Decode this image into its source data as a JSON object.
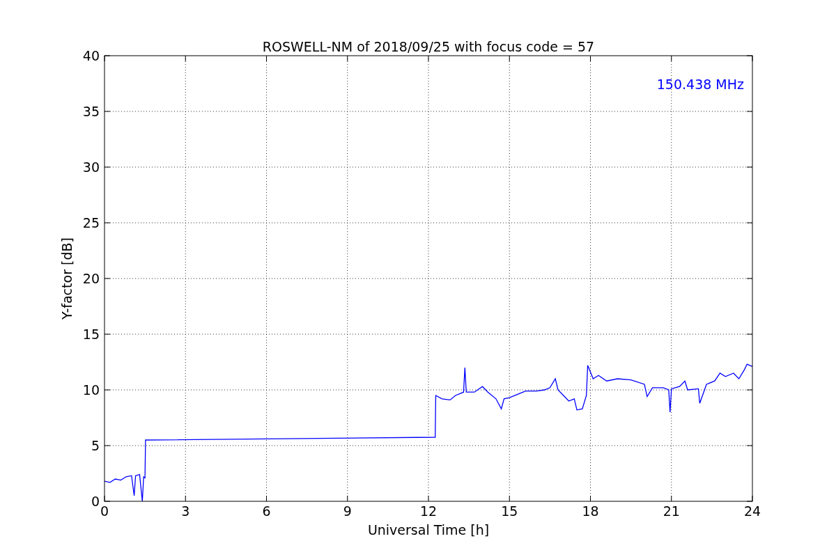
{
  "figure": {
    "chart_data": {
      "type": "line",
      "title": "ROSWELL-NM of 2018/09/25 with focus code = 57",
      "xlabel": "Universal Time [h]",
      "ylabel": "Y-factor [dB]",
      "x": [
        0,
        0.2,
        0.4,
        0.6,
        0.8,
        1.0,
        1.1,
        1.15,
        1.3,
        1.4,
        1.45,
        1.5,
        1.52,
        12.25,
        12.27,
        12.5,
        12.8,
        13.0,
        13.3,
        13.35,
        13.4,
        13.7,
        14.0,
        14.2,
        14.5,
        14.7,
        14.8,
        15.0,
        15.3,
        15.6,
        16.0,
        16.3,
        16.5,
        16.7,
        16.8,
        17.0,
        17.2,
        17.4,
        17.5,
        17.7,
        17.85,
        17.9,
        18.1,
        18.3,
        18.6,
        19.0,
        19.5,
        20.0,
        20.1,
        20.3,
        20.7,
        20.9,
        20.95,
        21.0,
        21.3,
        21.5,
        21.6,
        22.0,
        22.05,
        22.3,
        22.6,
        22.8,
        23.0,
        23.3,
        23.5,
        23.7,
        23.8,
        24.0
      ],
      "series": [
        {
          "name": "150.438 MHz",
          "color": "#0000ff",
          "values": [
            1.8,
            1.7,
            2.0,
            1.9,
            2.2,
            2.3,
            0.5,
            2.3,
            2.4,
            0.0,
            2.2,
            2.1,
            5.5,
            5.75,
            9.5,
            9.2,
            9.1,
            9.5,
            9.8,
            12.0,
            9.8,
            9.8,
            10.3,
            9.8,
            9.2,
            8.3,
            9.2,
            9.3,
            9.6,
            9.9,
            9.9,
            10.0,
            10.2,
            11.0,
            10.0,
            9.5,
            9.0,
            9.2,
            8.2,
            8.3,
            9.5,
            12.2,
            11.0,
            11.3,
            10.8,
            11.0,
            10.9,
            10.5,
            9.4,
            10.2,
            10.2,
            10.0,
            8.0,
            10.1,
            10.3,
            10.8,
            10.0,
            10.1,
            8.8,
            10.5,
            10.8,
            11.5,
            11.2,
            11.5,
            11.0,
            11.8,
            12.3,
            12.1
          ]
        }
      ],
      "xlim": [
        0,
        24
      ],
      "ylim": [
        0,
        40
      ],
      "xticks": [
        0,
        3,
        6,
        9,
        12,
        15,
        18,
        21,
        24
      ],
      "yticks": [
        0,
        5,
        10,
        15,
        20,
        25,
        30,
        35,
        40
      ],
      "grid": true
    }
  }
}
